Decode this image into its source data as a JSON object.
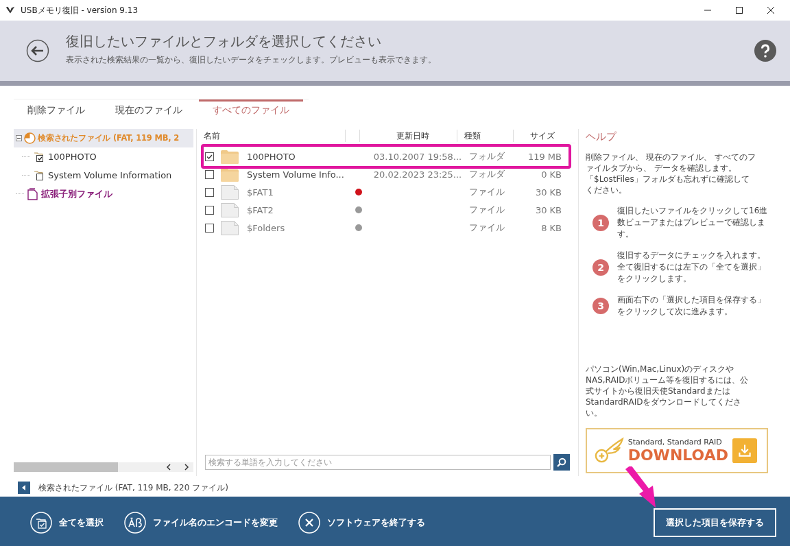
{
  "window": {
    "title": "USBメモリ復旧 - version 9.13"
  },
  "header": {
    "title": "復旧したいファイルとフォルダを選択してください",
    "subtitle": "表示された検索結果の一覧から、復旧したいデータをチェックします。プレビューも表示できます。"
  },
  "tabs": [
    {
      "label": "削除ファイル",
      "selected": false
    },
    {
      "label": "現在のファイル",
      "selected": false
    },
    {
      "label": "すべてのファイル",
      "selected": true
    }
  ],
  "tree": {
    "root": {
      "label": "検索されたファイル (FAT, 119 MB, 2",
      "expanded": true,
      "selected": true,
      "children": [
        {
          "label": "100PHOTO",
          "checked": true
        },
        {
          "label": "System Volume Information",
          "checked": false
        }
      ]
    },
    "extra": {
      "label": "拡張子別ファイル"
    }
  },
  "table": {
    "columns": [
      "名前",
      "更新日時",
      "種類",
      "サイズ"
    ],
    "rows": [
      {
        "kind": "folder",
        "checked": true,
        "name": "100PHOTO",
        "modified": "03.10.2007 19:58...",
        "type": "フォルダ",
        "size": "119 MB"
      },
      {
        "kind": "folder",
        "checked": false,
        "name": "System Volume Info...",
        "modified": "20.02.2023 23:25...",
        "type": "フォルダ",
        "size": "0 KB"
      },
      {
        "kind": "file",
        "checked": false,
        "name": "$FAT1",
        "color": "#d0121b",
        "type": "ファイル",
        "size": "30 KB"
      },
      {
        "kind": "file",
        "checked": false,
        "name": "$FAT2",
        "color": "#999999",
        "type": "ファイル",
        "size": "30 KB"
      },
      {
        "kind": "file",
        "checked": false,
        "name": "$Folders",
        "color": "#999999",
        "type": "ファイル",
        "size": "8 KB"
      }
    ]
  },
  "search": {
    "placeholder": "検索する単語を入力してください"
  },
  "help": {
    "title": "ヘルプ",
    "intro": "削除ファイル、 現在のファイル、 すべてのファイルタブから、 データを確認します。「$LostFiles」フォルダも忘れずに確認してください。",
    "steps": [
      {
        "number": "1",
        "text": "復旧したいファイルをクリックして16進数ビューアまたはプレビューで確認します。"
      },
      {
        "number": "2",
        "text": "復旧するデータにチェックを入れます。全て復旧するには左下の「全てを選択」をクリックします。"
      },
      {
        "number": "3",
        "text": "画面右下の「選択した項目を保存する」をクリックして次に進みます。"
      }
    ],
    "promo": "パソコン(Win,Mac,Linux)のディスクやNAS,RAIDボリューム等を復旧するには、公式サイトから復旧天使Standardまたは StandardRAIDをダウンロードしてください。",
    "banner": {
      "caption": "Standard, Standard RAID",
      "label": "DOWNLOAD"
    }
  },
  "status_bar": "検索されたファイル (FAT, 119 MB, 220 ファイル)",
  "footer": {
    "actions": [
      {
        "kind": "select-all",
        "label": "全てを選択"
      },
      {
        "kind": "encoding",
        "label": "ファイル名のエンコードを変更"
      },
      {
        "kind": "exit",
        "label": "ソフトウェアを終了する"
      }
    ],
    "primary": "選択した項目を保存する"
  }
}
